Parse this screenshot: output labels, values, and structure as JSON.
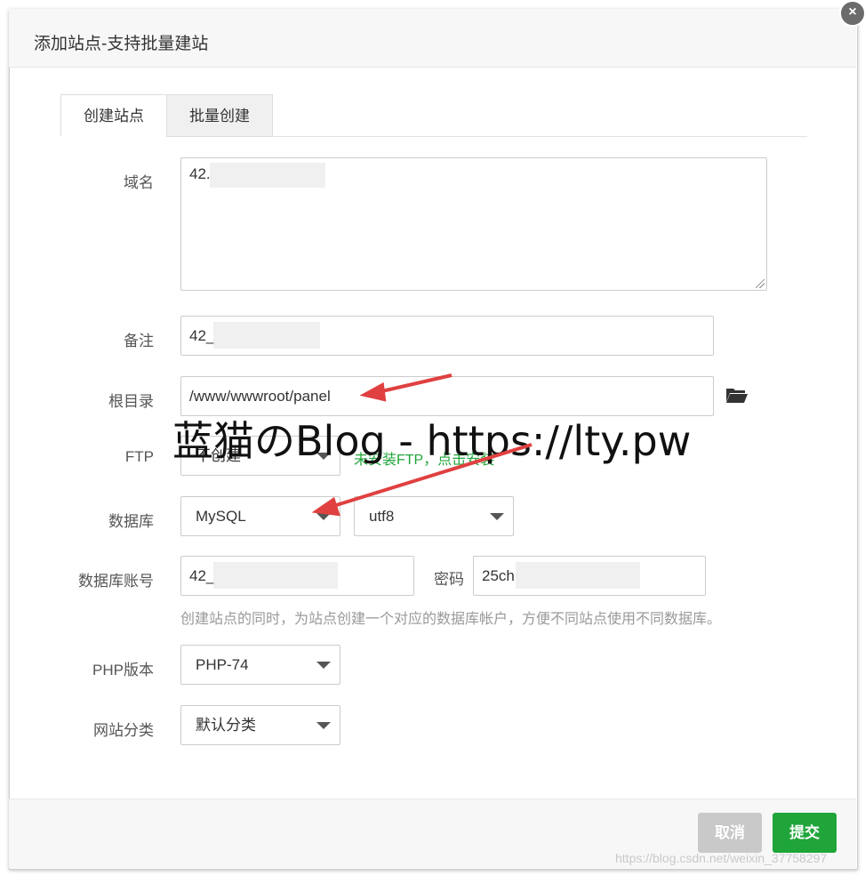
{
  "dialog": {
    "title": "添加站点-支持批量建站",
    "close_icon": "×"
  },
  "tabs": [
    {
      "label": "创建站点"
    },
    {
      "label": "批量创建"
    }
  ],
  "form": {
    "domain": {
      "label": "域名",
      "value": "42."
    },
    "remark": {
      "label": "备注",
      "value": "42_"
    },
    "root": {
      "label": "根目录",
      "value": "/www/wwwroot/panel"
    },
    "ftp": {
      "label": "FTP",
      "selected": "不创建",
      "hint": "未安装FTP，点击安装",
      "hint_color": "#20a53a"
    },
    "database": {
      "label": "数据库",
      "type_selected": "MySQL",
      "charset_selected": "utf8"
    },
    "db_account": {
      "label": "数据库账号",
      "value": "42_",
      "password_label": "密码",
      "password_value": "25ch"
    },
    "db_hint": "创建站点的同时，为站点创建一个对应的数据库帐户，方便不同站点使用不同数据库。",
    "php": {
      "label": "PHP版本",
      "selected": "PHP-74"
    },
    "category": {
      "label": "网站分类",
      "selected": "默认分类"
    }
  },
  "footer": {
    "cancel_label": "取消",
    "submit_label": "提交"
  },
  "overlay": {
    "watermark": "蓝猫のBlog - https://lty.pw",
    "csdn_watermark": "https://blog.csdn.net/weixin_37758297"
  },
  "colors": {
    "accent": "#20a53a",
    "arrow": "#e04040"
  }
}
